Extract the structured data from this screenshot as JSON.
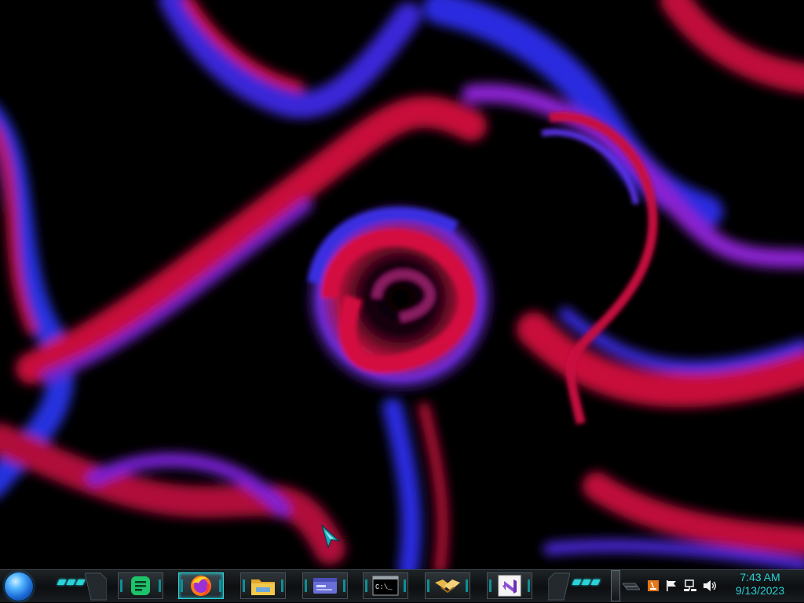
{
  "desktop": {
    "wallpaper": "abstract-red-purple-swirl",
    "colors": {
      "background": "#000000",
      "red": "#d0103a",
      "purple": "#7a1fd0",
      "blue": "#2b2fe0"
    }
  },
  "taskbar": {
    "accent_color": "#29d3d9",
    "start_button": "start-orb-icon",
    "pinned_apps": [
      {
        "name": "Sticky Notes",
        "icon": "notes-icon",
        "color": "#1ec26a"
      },
      {
        "name": "Firefox",
        "icon": "firefox-icon",
        "color": "#ff7a18"
      },
      {
        "name": "File Explorer",
        "icon": "folder-icon",
        "color": "#f2c94c"
      },
      {
        "name": "Control Panel",
        "icon": "window-card-icon",
        "color": "#6a6fd8"
      },
      {
        "name": "Command Prompt",
        "icon": "terminal-icon",
        "color": "#000000",
        "glyph": "C:\\_"
      },
      {
        "name": "Sync Center",
        "icon": "handshake-icon",
        "color": "#e8b64a"
      },
      {
        "name": "Visual Studio",
        "icon": "visual-studio-icon",
        "color": "#8e4fd1"
      }
    ]
  },
  "tray": {
    "icons": [
      "java-icon",
      "flag-icon",
      "network-icon",
      "speaker-icon"
    ],
    "clock": {
      "time": "7:43 AM",
      "date": "9/13/2023"
    }
  }
}
